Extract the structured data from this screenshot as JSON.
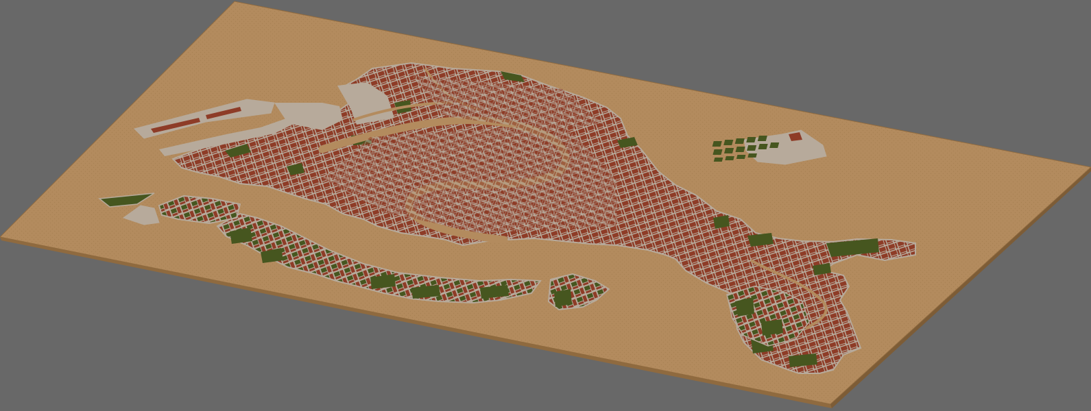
{
  "scene": {
    "background_color": "#686868",
    "board": {
      "top_color": "#b38b5e",
      "edge_color": "#8f6a3f",
      "texture_color": "#a88254"
    },
    "land": {
      "pavement_color": "#b7aa9b",
      "building_color": "#8e3c27",
      "garden_color": "#46561f",
      "canal_color": "#b38b5e"
    },
    "regions": [
      "main-islands",
      "grand-canal",
      "giudecca",
      "san-giorgio-maggiore",
      "san-michele-cemetery",
      "sant-elena",
      "port-piers",
      "western-islet"
    ]
  }
}
